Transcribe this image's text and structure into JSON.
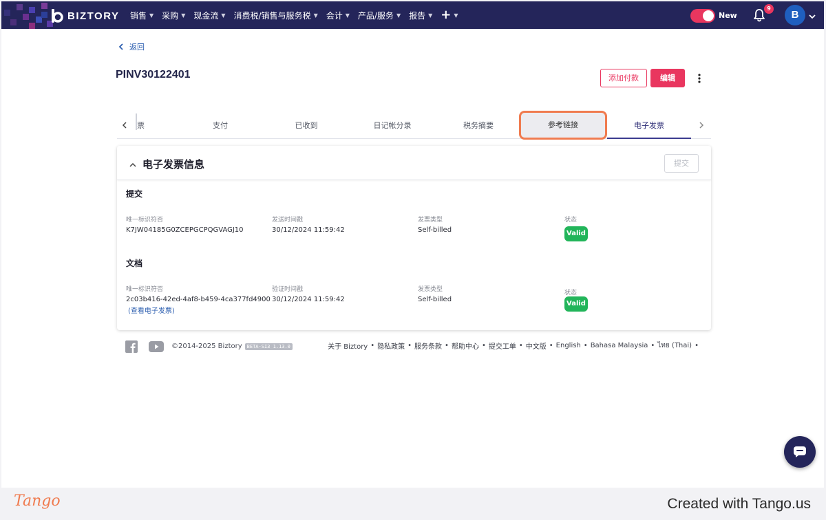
{
  "app": {
    "brand": "BIZTORY",
    "colors": {
      "nav_bg": "#24255a",
      "accent": "#e9365f",
      "link": "#2d5fb0",
      "valid": "#22b55a",
      "tango": "#f07b4f"
    }
  },
  "nav": {
    "menu": [
      {
        "label": "销售",
        "icon": "chevron-down-icon"
      },
      {
        "label": "采购",
        "icon": "chevron-down-icon"
      },
      {
        "label": "现金流",
        "icon": "chevron-down-icon"
      },
      {
        "label": "消费税/销售与服务税",
        "icon": "chevron-down-icon"
      },
      {
        "label": "会计",
        "icon": "chevron-down-icon"
      },
      {
        "label": "产品/服务",
        "icon": "chevron-down-icon"
      },
      {
        "label": "报告",
        "icon": "chevron-down-icon"
      }
    ],
    "plus_icon": "plus-icon",
    "toggle_label": "New",
    "notification_count": "9",
    "avatar_initial": "B"
  },
  "page": {
    "back_label": "返回",
    "invoice_number": "PINV30122401",
    "add_payment_label": "添加付款",
    "edit_label": "编辑"
  },
  "tabs": [
    {
      "label": "票"
    },
    {
      "label": "支付"
    },
    {
      "label": "已收到"
    },
    {
      "label": "日记帐分录"
    },
    {
      "label": "税务摘要"
    },
    {
      "label": "参考链接"
    },
    {
      "label": "电子发票"
    }
  ],
  "panel": {
    "title": "电子发票信息",
    "submit_label": "提交",
    "submission": {
      "section_title": "提交",
      "uid_label": "唯一标识符否",
      "uid_value": "K7JW04185G0ZCEPGCPQGVAGJ10",
      "time_label": "发送时间戳",
      "time_value": "30/12/2024 11:59:42",
      "type_label": "发票类型",
      "type_value": "Self-billed",
      "status_label": "状态",
      "status_value": "Valid"
    },
    "document": {
      "section_title": "文档",
      "uid_label": "唯一标识符否",
      "uid_value": "2c03b416-42ed-4af8-b459-4ca377fd4900",
      "view_link": "(查看电子发票)",
      "time_label": "验证时间戳",
      "time_value": "30/12/2024 11:59:42",
      "type_label": "发票类型",
      "type_value": "Self-billed",
      "status_label": "状态",
      "status_value": "Valid"
    }
  },
  "footer": {
    "copyright": "©2014-2025 Biztory",
    "version": "BETA-SI3 1.13.0",
    "links": [
      "关于 Biztory",
      "隐私政策",
      "服务条款",
      "帮助中心",
      "提交工单",
      "中文版",
      "English",
      "Bahasa Malaysia",
      "ไทย (Thai)"
    ],
    "separator": "•",
    "trailing_separator": "•"
  },
  "tango": {
    "brand": "Tango",
    "credit": "Created with Tango.us"
  }
}
